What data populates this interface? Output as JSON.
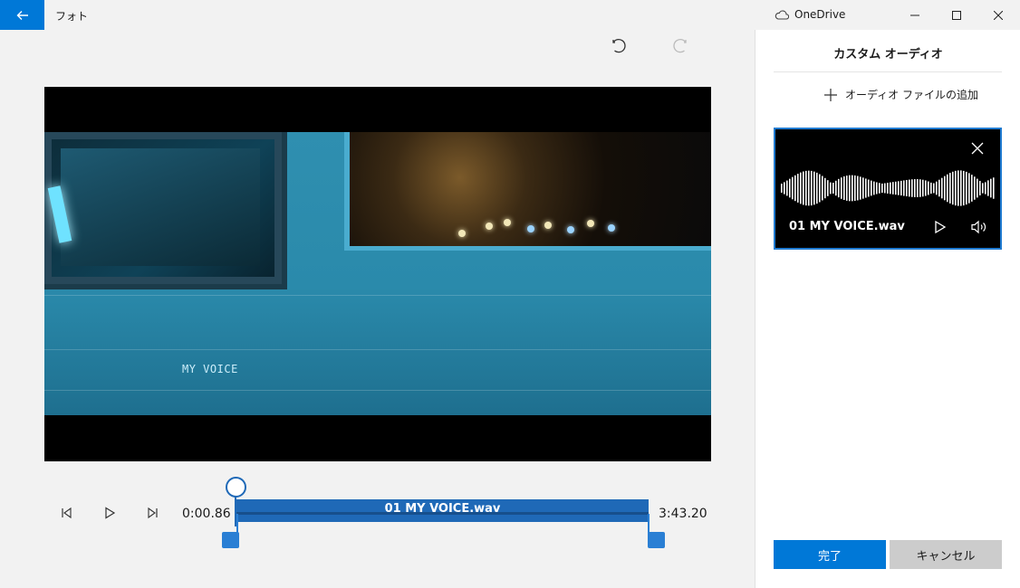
{
  "titlebar": {
    "app_title": "フォト",
    "account": "OneDrive"
  },
  "icons": {
    "back": "back-arrow-icon",
    "cloud": "cloud-icon",
    "minimize": "minimize-icon",
    "maximize": "maximize-icon",
    "close": "close-icon",
    "undo": "undo-icon",
    "redo": "redo-icon",
    "prev": "step-back-icon",
    "play": "play-icon",
    "next": "step-forward-icon",
    "add": "plus-icon",
    "remove": "close-icon",
    "volume": "volume-icon"
  },
  "video": {
    "overlay_text": "MY VOICE"
  },
  "playback": {
    "current_time": "0:00.86",
    "total_time": "3:43.20",
    "clip_label": "01 MY VOICE.wav",
    "scrub_position": 0.0
  },
  "panel": {
    "title": "カスタム オーディオ",
    "add_audio_label": "オーディオ ファイルの追加",
    "audio_card": {
      "file_name": "01 MY VOICE.wav"
    },
    "done_label": "完了",
    "cancel_label": "キャンセル"
  },
  "colors": {
    "accent": "#0078d7",
    "track": "#1f69b7"
  }
}
